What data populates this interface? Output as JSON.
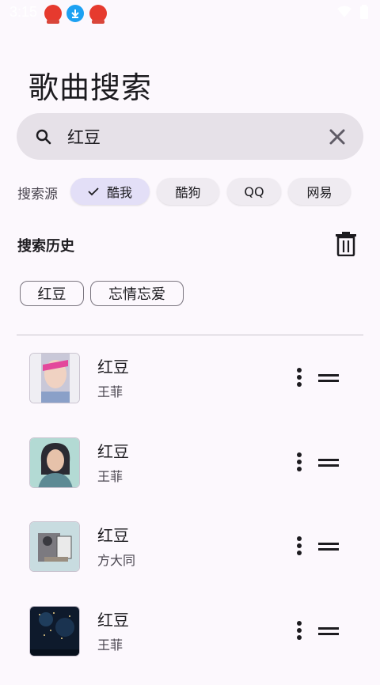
{
  "status_bar": {
    "time": "3:15"
  },
  "page": {
    "title": "歌曲搜索"
  },
  "search": {
    "value": "红豆",
    "placeholder": ""
  },
  "sources": {
    "label": "搜索源",
    "options": [
      {
        "label": "酷我",
        "selected": true
      },
      {
        "label": "酷狗",
        "selected": false
      },
      {
        "label": "QQ",
        "selected": false
      },
      {
        "label": "网易",
        "selected": false
      }
    ]
  },
  "history": {
    "title": "搜索历史",
    "items": [
      "红豆",
      "忘情忘爱"
    ]
  },
  "songs": [
    {
      "title": "红豆",
      "artist": "王菲"
    },
    {
      "title": "红豆",
      "artist": "王菲"
    },
    {
      "title": "红豆",
      "artist": "方大同"
    },
    {
      "title": "红豆",
      "artist": "王菲"
    }
  ],
  "colors": {
    "background": "#fcf8fd",
    "search_bg": "#e6e1e8",
    "chip_selected": "#e3dff7",
    "chip_default": "#efebf1"
  }
}
